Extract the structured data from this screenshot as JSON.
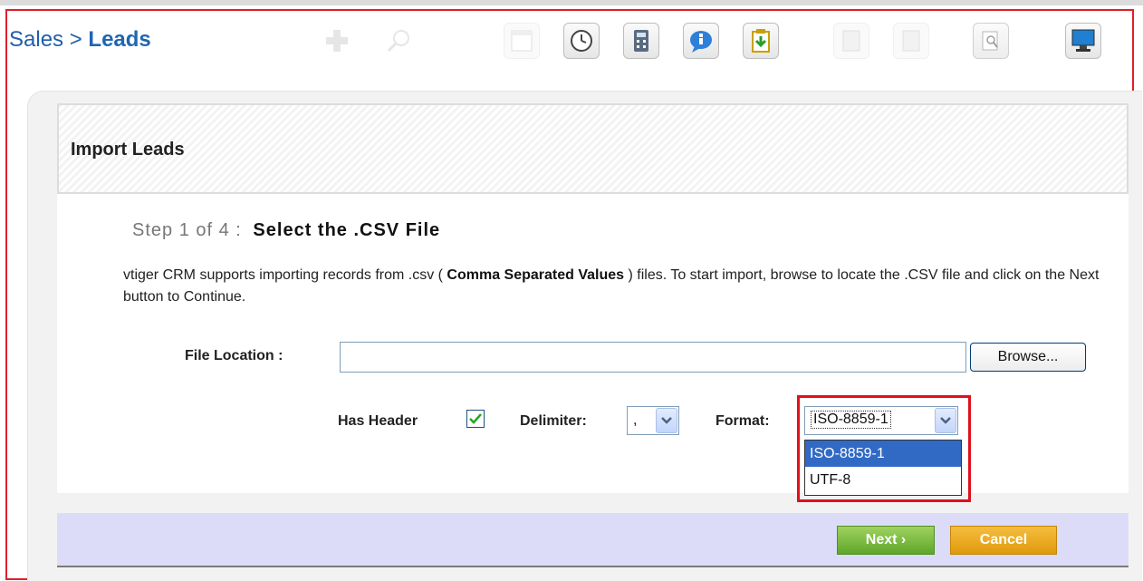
{
  "breadcrumb": {
    "module": "Sales",
    "separator": ">",
    "page": "Leads"
  },
  "toolbar": {
    "icons": [
      "add-icon",
      "search-icon",
      "calendar-icon",
      "clock-icon",
      "calculator-icon",
      "chat-icon",
      "import-icon",
      "export-icon",
      "export-alt-icon",
      "find-duplicates-icon",
      "desktop-icon"
    ]
  },
  "header": {
    "title": "Import Leads"
  },
  "step": {
    "label": "Step 1 of 4 :",
    "title": "Select the .CSV File"
  },
  "description": {
    "prefix": "vtiger CRM supports importing records from .csv ( ",
    "bold": "Comma Separated Values",
    "suffix": " ) files. To start import, browse to locate the .CSV file and click on the Next button to Continue."
  },
  "file": {
    "label": "File Location :",
    "value": "",
    "browse_label": "Browse..."
  },
  "options": {
    "has_header_label": "Has Header",
    "has_header_checked": true,
    "delimiter_label": "Delimiter:",
    "delimiter_value": ",",
    "format_label": "Format:",
    "format_value": "ISO-8859-1",
    "format_options": [
      "ISO-8859-1",
      "UTF-8"
    ]
  },
  "buttons": {
    "next": "Next ›",
    "cancel": "Cancel"
  },
  "colors": {
    "accent": "#1f66b3",
    "highlight": "#e0101c",
    "next": "#6bb22f",
    "cancel": "#e6a21a"
  }
}
